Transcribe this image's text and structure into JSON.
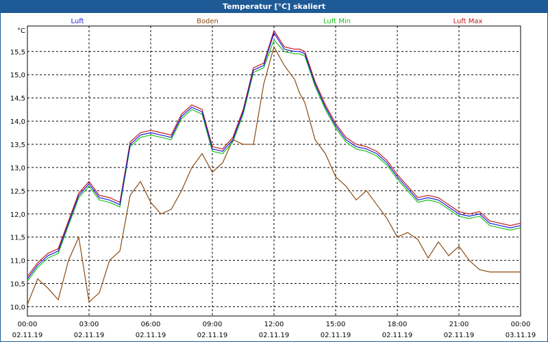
{
  "window": {
    "title": "Temperatur [°C] skaliert"
  },
  "colors": {
    "titlebar": "#1e5a96",
    "luft": "#1a1ae0",
    "boden": "#8b4a10",
    "luft_min": "#18c018",
    "luft_max": "#c01818",
    "grid": "#000000"
  },
  "chart_data": {
    "type": "line",
    "title": "Temperatur [°C] skaliert",
    "ylabel": "°C",
    "xlabel": "",
    "ylim": [
      9.8,
      16.05
    ],
    "xlim": [
      0,
      24
    ],
    "grid": true,
    "legend": "top",
    "yticks": [
      "10,0",
      "10,5",
      "11,0",
      "11,5",
      "12,0",
      "12,5",
      "13,0",
      "13,5",
      "14,0",
      "14,5",
      "15,0",
      "15,5"
    ],
    "ytick_values": [
      10.0,
      10.5,
      11.0,
      11.5,
      12.0,
      12.5,
      13.0,
      13.5,
      14.0,
      14.5,
      15.0,
      15.5
    ],
    "xticks": [
      {
        "value": 0,
        "time": "00:00",
        "date": "02.11.19"
      },
      {
        "value": 3,
        "time": "03:00",
        "date": "02.11.19"
      },
      {
        "value": 6,
        "time": "06:00",
        "date": "02.11.19"
      },
      {
        "value": 9,
        "time": "09:00",
        "date": "02.11.19"
      },
      {
        "value": 12,
        "time": "12:00",
        "date": "02.11.19"
      },
      {
        "value": 15,
        "time": "15:00",
        "date": "02.11.19"
      },
      {
        "value": 18,
        "time": "18:00",
        "date": "02.11.19"
      },
      {
        "value": 21,
        "time": "21:00",
        "date": "02.11.19"
      },
      {
        "value": 24,
        "time": "00:00",
        "date": "03.11.19"
      }
    ],
    "x": [
      0,
      0.5,
      1,
      1.5,
      2,
      2.5,
      3,
      3.5,
      4,
      4.5,
      5,
      5.5,
      6,
      6.5,
      7,
      7.5,
      8,
      8.5,
      9,
      9.5,
      10,
      10.5,
      11,
      11.5,
      12,
      12.5,
      13,
      13.25,
      13.5,
      14,
      14.5,
      15,
      15.5,
      16,
      16.5,
      17,
      17.5,
      18,
      18.5,
      19,
      19.5,
      20,
      20.5,
      21,
      21.5,
      22,
      22.5,
      23,
      23.5,
      24
    ],
    "series": [
      {
        "name": "Luft",
        "values": [
          10.6,
          10.9,
          11.1,
          11.2,
          11.8,
          12.4,
          12.65,
          12.35,
          12.3,
          12.2,
          13.5,
          13.7,
          13.75,
          13.7,
          13.65,
          14.1,
          14.3,
          14.2,
          13.4,
          13.35,
          13.6,
          14.2,
          15.1,
          15.2,
          15.9,
          15.55,
          15.5,
          15.5,
          15.45,
          14.8,
          14.3,
          13.9,
          13.6,
          13.45,
          13.4,
          13.3,
          13.1,
          12.8,
          12.55,
          12.3,
          12.35,
          12.3,
          12.15,
          12.0,
          11.95,
          12.0,
          11.8,
          11.75,
          11.7,
          11.75
        ]
      },
      {
        "name": "Boden",
        "values": [
          10.05,
          10.6,
          10.4,
          10.15,
          11.0,
          11.5,
          10.1,
          10.3,
          11.0,
          11.2,
          12.4,
          12.7,
          12.25,
          12.0,
          12.1,
          12.5,
          13.0,
          13.3,
          12.9,
          13.1,
          13.6,
          13.5,
          13.5,
          14.8,
          15.6,
          15.2,
          14.9,
          14.6,
          14.4,
          13.6,
          13.3,
          12.8,
          12.6,
          12.3,
          12.5,
          12.2,
          11.9,
          11.5,
          11.6,
          11.45,
          11.05,
          11.4,
          11.1,
          11.3,
          11.0,
          10.8,
          10.75,
          10.75,
          10.75,
          10.75
        ]
      },
      {
        "name": "Luft Min",
        "values": [
          10.55,
          10.85,
          11.05,
          11.15,
          11.75,
          12.35,
          12.6,
          12.3,
          12.25,
          12.15,
          13.45,
          13.65,
          13.7,
          13.65,
          13.6,
          14.05,
          14.25,
          14.15,
          13.35,
          13.3,
          13.55,
          14.15,
          15.05,
          15.15,
          15.75,
          15.5,
          15.45,
          15.45,
          15.4,
          14.75,
          14.25,
          13.85,
          13.55,
          13.4,
          13.35,
          13.25,
          13.05,
          12.75,
          12.5,
          12.25,
          12.3,
          12.25,
          12.1,
          11.95,
          11.9,
          11.95,
          11.75,
          11.7,
          11.65,
          11.7
        ]
      },
      {
        "name": "Luft Max",
        "values": [
          10.65,
          10.95,
          11.15,
          11.25,
          11.85,
          12.45,
          12.7,
          12.4,
          12.35,
          12.25,
          13.55,
          13.75,
          13.8,
          13.75,
          13.7,
          14.15,
          14.35,
          14.25,
          13.45,
          13.4,
          13.65,
          14.25,
          15.15,
          15.25,
          15.95,
          15.6,
          15.55,
          15.55,
          15.5,
          14.85,
          14.35,
          13.95,
          13.65,
          13.5,
          13.45,
          13.35,
          13.15,
          12.85,
          12.6,
          12.35,
          12.4,
          12.35,
          12.2,
          12.05,
          12.0,
          12.05,
          11.85,
          11.8,
          11.75,
          11.8
        ]
      }
    ]
  }
}
